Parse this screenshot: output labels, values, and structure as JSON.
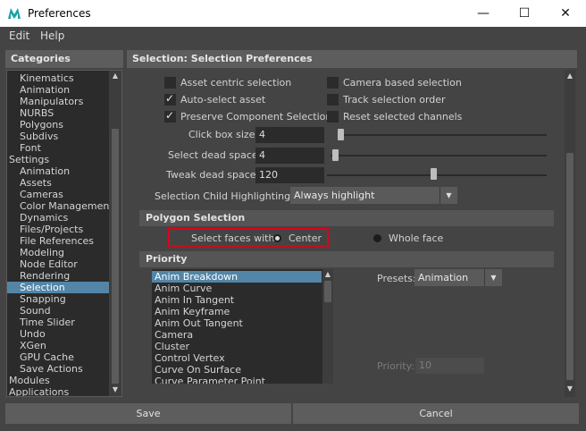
{
  "window": {
    "title": "Preferences",
    "minimize": "—",
    "maximize": "☐",
    "close": "✕"
  },
  "menu": [
    "Edit",
    "Help"
  ],
  "categories": {
    "header": "Categories",
    "items": [
      "Kinematics",
      "Animation",
      "Manipulators",
      "NURBS",
      "Polygons",
      "Subdivs",
      "Font",
      "Settings",
      "Animation",
      "Assets",
      "Cameras",
      "Color Management",
      "Dynamics",
      "Files/Projects",
      "File References",
      "Modeling",
      "Node Editor",
      "Rendering",
      "Selection",
      "Snapping",
      "Sound",
      "Time Slider",
      "Undo",
      "XGen",
      "GPU Cache",
      "Save Actions",
      "Modules",
      "Applications"
    ],
    "selected": "Selection"
  },
  "main": {
    "header": "Selection: Selection Preferences",
    "checkboxes": [
      {
        "label": "Asset centric selection",
        "checked": false
      },
      {
        "label": "Camera based selection",
        "checked": false
      },
      {
        "label": "Auto-select asset",
        "checked": true
      },
      {
        "label": "Track selection order",
        "checked": false
      },
      {
        "label": "Preserve Component Selections",
        "checked": true
      },
      {
        "label": "Reset selected channels",
        "checked": false
      }
    ],
    "sliders": [
      {
        "label": "Click box size:",
        "value": "4"
      },
      {
        "label": "Select dead space:",
        "value": "4"
      },
      {
        "label": "Tweak dead space:",
        "value": "120"
      }
    ],
    "child_highlighting": {
      "label": "Selection Child Highlighting:",
      "value": "Always highlight"
    },
    "polygon_selection": {
      "header": "Polygon Selection",
      "label": "Select faces with:",
      "options": [
        "Center",
        "Whole face"
      ],
      "selected": "Center"
    },
    "priority": {
      "header": "Priority",
      "items": [
        "Anim Breakdown",
        "Anim Curve",
        "Anim In Tangent",
        "Anim Keyframe",
        "Anim Out Tangent",
        "Camera",
        "Cluster",
        "Control Vertex",
        "Curve On Surface",
        "Curve Parameter Point"
      ],
      "selected": "Anim Breakdown",
      "presets_label": "Presets:",
      "presets_value": "Animation",
      "priority_label": "Priority:",
      "priority_value": "10"
    }
  },
  "buttons": {
    "save": "Save",
    "cancel": "Cancel"
  },
  "colors": {
    "highlight": "#5285a6",
    "annotation": "#e0001a",
    "background": "#444444"
  }
}
